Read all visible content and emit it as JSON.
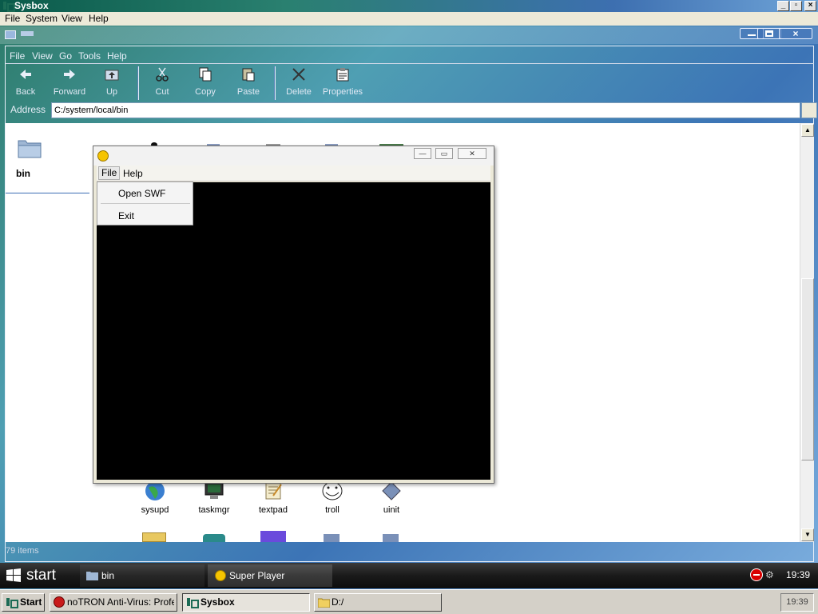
{
  "sysbox": {
    "title": "Sysbox",
    "menu": [
      "File",
      "System",
      "View",
      "Help"
    ]
  },
  "explorer": {
    "menu": [
      "File",
      "View",
      "Go",
      "Tools",
      "Help"
    ],
    "toolbar": {
      "back": "Back",
      "forward": "Forward",
      "up": "Up",
      "cut": "Cut",
      "copy": "Copy",
      "paste": "Paste",
      "delete": "Delete",
      "properties": "Properties"
    },
    "address_label": "Address",
    "address_value": "C:/system/local/bin",
    "sidebar_folder": "bin",
    "status": "79 items",
    "files_row": [
      "sysupd",
      "taskmgr",
      "textpad",
      "troll",
      "uinit"
    ]
  },
  "super_player": {
    "menu": [
      "File",
      "Help"
    ],
    "file_menu_items": [
      "Open SWF",
      "Exit"
    ]
  },
  "taskbar_top": {
    "start": "start",
    "tasks": [
      "bin",
      "Super Player"
    ],
    "clock": "19:39"
  },
  "taskbar_bottom": {
    "start": "Start",
    "tasks": [
      "noTRON Anti-Virus: Profes...",
      "Sysbox",
      "D:/"
    ],
    "clock": "19:39"
  },
  "colors": {
    "video_bg": "#000000",
    "taskbar_top": "#1a1a1a",
    "taskbar_bottom": "#d4d0c8"
  }
}
